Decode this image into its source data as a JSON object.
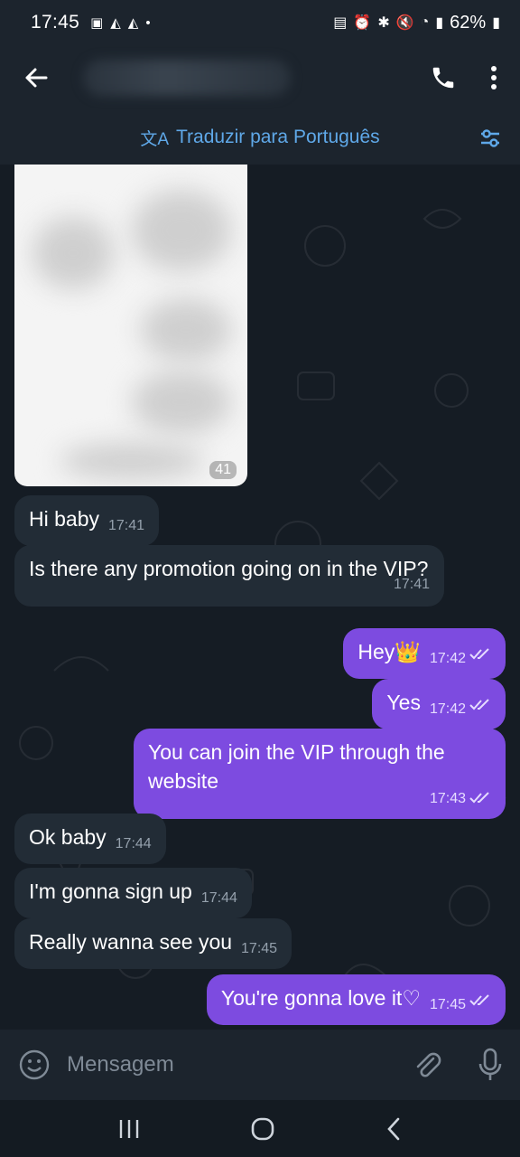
{
  "status_bar": {
    "time": "17:45",
    "battery": "62%"
  },
  "header": {
    "translate_label": "Traduzir para Português"
  },
  "photo": {
    "timestamp": "41"
  },
  "messages": [
    {
      "direction": "in",
      "text": "Hi baby",
      "time": "17:41"
    },
    {
      "direction": "in",
      "text": "Is there any promotion going on in the VIP?",
      "time": "17:41"
    },
    {
      "direction": "out",
      "text": "Hey👑",
      "time": "17:42"
    },
    {
      "direction": "out",
      "text": "Yes",
      "time": "17:42"
    },
    {
      "direction": "out",
      "text": "You can join the VIP through the website",
      "time": "17:43"
    },
    {
      "direction": "in",
      "text": "Ok baby",
      "time": "17:44"
    },
    {
      "direction": "in",
      "text": "I'm gonna sign up",
      "time": "17:44"
    },
    {
      "direction": "in",
      "text": "Really wanna see you",
      "time": "17:45"
    },
    {
      "direction": "out",
      "text": "You're gonna love it♡",
      "time": "17:45"
    }
  ],
  "composer": {
    "placeholder": "Mensagem"
  },
  "colors": {
    "outgoing_bubble": "#7d4be0",
    "incoming_bubble": "#222c36",
    "accent": "#5fa8e8"
  }
}
